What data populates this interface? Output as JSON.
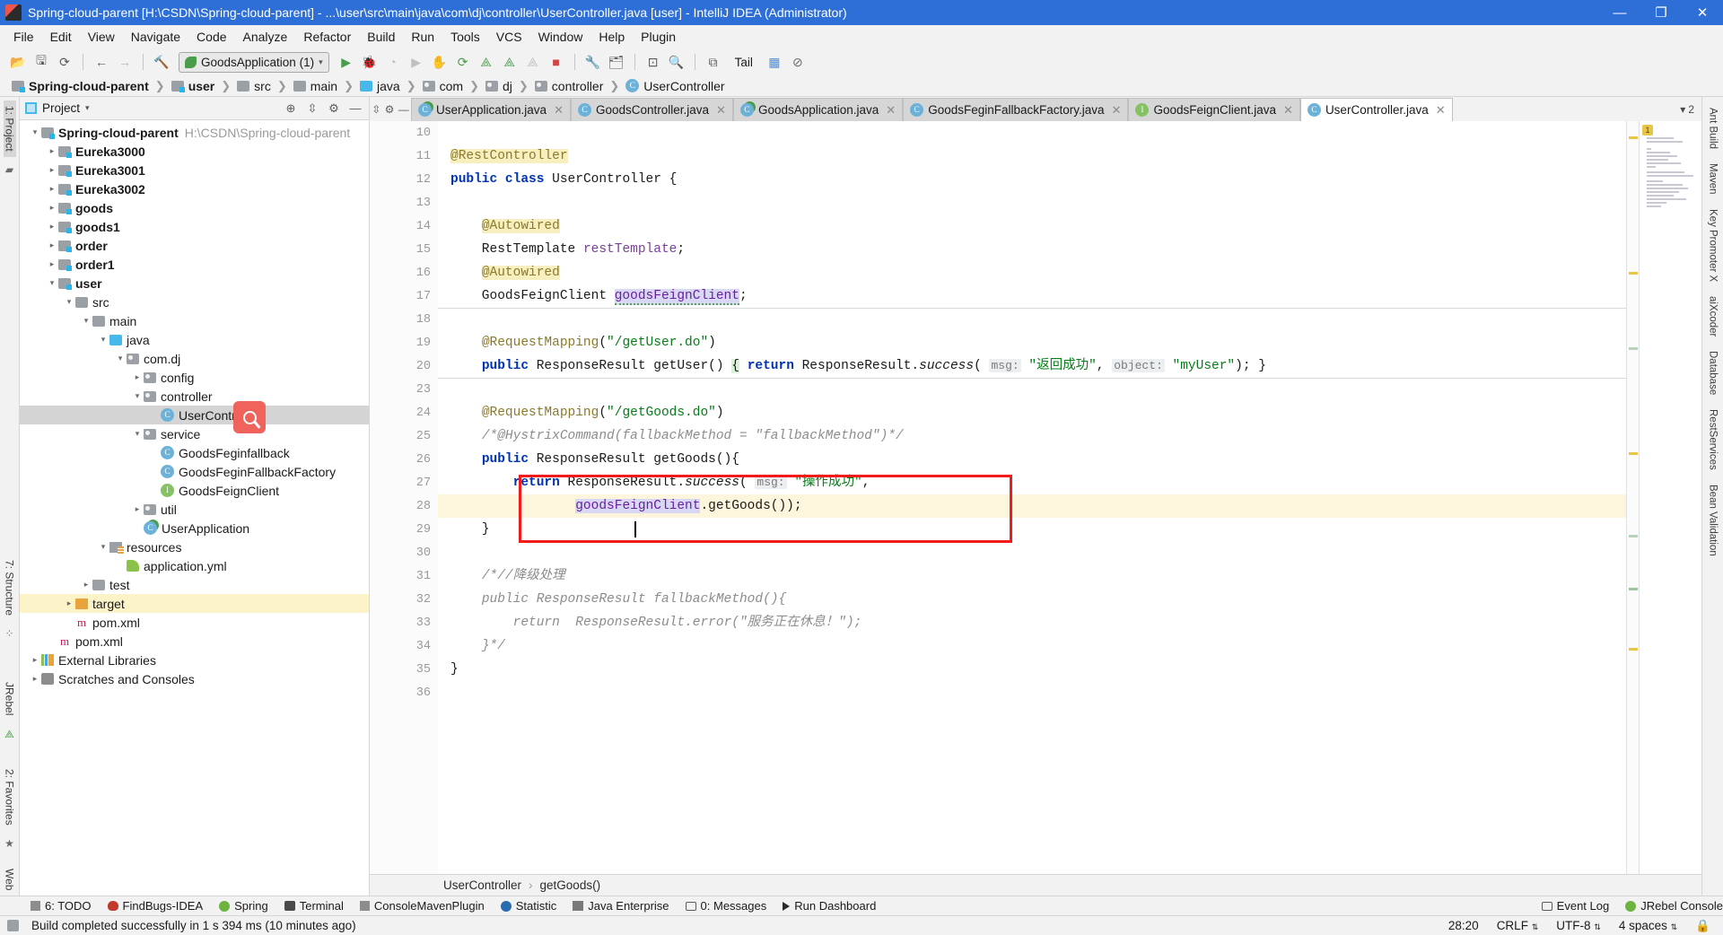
{
  "window": {
    "title": "Spring-cloud-parent [H:\\CSDN\\Spring-cloud-parent] - ...\\user\\src\\main\\java\\com\\dj\\controller\\UserController.java [user] - IntelliJ IDEA (Administrator)",
    "minimize": "—",
    "maximize": "❐",
    "close": "✕"
  },
  "menu": [
    "File",
    "Edit",
    "View",
    "Navigate",
    "Code",
    "Analyze",
    "Refactor",
    "Build",
    "Run",
    "Tools",
    "VCS",
    "Window",
    "Help",
    "Plugin"
  ],
  "toolbar": {
    "run_config": "GoodsApplication (1)",
    "tail_label": "Tail"
  },
  "breadcrumb": [
    {
      "label": "Spring-cloud-parent",
      "icon": "module-folder-icon",
      "bold": true
    },
    {
      "label": "user",
      "icon": "module-folder-icon",
      "bold": true
    },
    {
      "label": "src",
      "icon": "folder-icon",
      "bold": false
    },
    {
      "label": "main",
      "icon": "folder-icon",
      "bold": false
    },
    {
      "label": "java",
      "icon": "source-folder-icon",
      "bold": false
    },
    {
      "label": "com",
      "icon": "package-icon",
      "bold": false
    },
    {
      "label": "dj",
      "icon": "package-icon",
      "bold": false
    },
    {
      "label": "controller",
      "icon": "package-icon",
      "bold": false
    },
    {
      "label": "UserController",
      "icon": "class-icon",
      "bold": false
    }
  ],
  "left_rail": [
    "1: Project"
  ],
  "left_rail_lower": [
    "7: Structure",
    "JRebel",
    "2: Favorites",
    "Web"
  ],
  "right_rail": [
    "Ant Build",
    "Maven",
    "Key Promoter X",
    "aiXcoder",
    "Database",
    "RestServices",
    "Bean Validation"
  ],
  "project_panel": {
    "title": "Project",
    "tree": [
      {
        "indent": 0,
        "arrow": "open",
        "icon": "module-folder-icon",
        "label": "Spring-cloud-parent",
        "bold": true,
        "path": "H:\\CSDN\\Spring-cloud-parent"
      },
      {
        "indent": 1,
        "arrow": "closed",
        "icon": "module-folder-icon",
        "label": "Eureka3000",
        "bold": true,
        "path": ""
      },
      {
        "indent": 1,
        "arrow": "closed",
        "icon": "module-folder-icon",
        "label": "Eureka3001",
        "bold": true,
        "path": ""
      },
      {
        "indent": 1,
        "arrow": "closed",
        "icon": "module-folder-icon",
        "label": "Eureka3002",
        "bold": true,
        "path": ""
      },
      {
        "indent": 1,
        "arrow": "closed",
        "icon": "module-folder-icon",
        "label": "goods",
        "bold": true,
        "path": ""
      },
      {
        "indent": 1,
        "arrow": "closed",
        "icon": "module-folder-icon",
        "label": "goods1",
        "bold": true,
        "path": ""
      },
      {
        "indent": 1,
        "arrow": "closed",
        "icon": "module-folder-icon",
        "label": "order",
        "bold": true,
        "path": ""
      },
      {
        "indent": 1,
        "arrow": "closed",
        "icon": "module-folder-icon",
        "label": "order1",
        "bold": true,
        "path": ""
      },
      {
        "indent": 1,
        "arrow": "open",
        "icon": "module-folder-icon",
        "label": "user",
        "bold": true,
        "path": ""
      },
      {
        "indent": 2,
        "arrow": "open",
        "icon": "folder-icon",
        "label": "src",
        "bold": false,
        "path": ""
      },
      {
        "indent": 3,
        "arrow": "open",
        "icon": "folder-icon",
        "label": "main",
        "bold": false,
        "path": ""
      },
      {
        "indent": 4,
        "arrow": "open",
        "icon": "source-folder-icon",
        "label": "java",
        "bold": false,
        "path": ""
      },
      {
        "indent": 5,
        "arrow": "open",
        "icon": "package-icon",
        "label": "com.dj",
        "bold": false,
        "path": ""
      },
      {
        "indent": 6,
        "arrow": "closed",
        "icon": "package-icon",
        "label": "config",
        "bold": false,
        "path": ""
      },
      {
        "indent": 6,
        "arrow": "open",
        "icon": "package-icon",
        "label": "controller",
        "bold": false,
        "path": ""
      },
      {
        "indent": 7,
        "arrow": "none",
        "icon": "class-icon",
        "label": "UserController",
        "bold": false,
        "path": "",
        "selected": true
      },
      {
        "indent": 6,
        "arrow": "open",
        "icon": "package-icon",
        "label": "service",
        "bold": false,
        "path": ""
      },
      {
        "indent": 7,
        "arrow": "none",
        "icon": "class-icon",
        "label": "GoodsFeginfallback",
        "bold": false,
        "path": ""
      },
      {
        "indent": 7,
        "arrow": "none",
        "icon": "class-icon",
        "label": "GoodsFeginFallbackFactory",
        "bold": false,
        "path": ""
      },
      {
        "indent": 7,
        "arrow": "none",
        "icon": "interface-icon",
        "label": "GoodsFeignClient",
        "bold": false,
        "path": ""
      },
      {
        "indent": 6,
        "arrow": "closed",
        "icon": "package-icon",
        "label": "util",
        "bold": false,
        "path": ""
      },
      {
        "indent": 6,
        "arrow": "none",
        "icon": "spring-class-icon",
        "label": "UserApplication",
        "bold": false,
        "path": ""
      },
      {
        "indent": 4,
        "arrow": "open",
        "icon": "resources-folder-icon",
        "label": "resources",
        "bold": false,
        "path": ""
      },
      {
        "indent": 5,
        "arrow": "none",
        "icon": "yaml-icon",
        "label": "application.yml",
        "bold": false,
        "path": ""
      },
      {
        "indent": 3,
        "arrow": "closed",
        "icon": "folder-icon",
        "label": "test",
        "bold": false,
        "path": ""
      },
      {
        "indent": 2,
        "arrow": "closed",
        "icon": "target-folder-icon",
        "label": "target",
        "bold": false,
        "path": "",
        "highlight": true
      },
      {
        "indent": 2,
        "arrow": "none",
        "icon": "maven-icon",
        "label": "pom.xml",
        "bold": false,
        "path": ""
      },
      {
        "indent": 1,
        "arrow": "none",
        "icon": "maven-icon",
        "label": "pom.xml",
        "bold": false,
        "path": ""
      },
      {
        "indent": 0,
        "arrow": "closed",
        "icon": "library-icon",
        "label": "External Libraries",
        "bold": false,
        "path": ""
      },
      {
        "indent": 0,
        "arrow": "closed",
        "icon": "console-icon",
        "label": "Scratches and Consoles",
        "bold": false,
        "path": ""
      }
    ]
  },
  "editor": {
    "tabs": [
      {
        "label": "UserApplication.java",
        "icon": "spring-class-icon",
        "active": false
      },
      {
        "label": "GoodsController.java",
        "icon": "class-icon",
        "active": false
      },
      {
        "label": "GoodsApplication.java",
        "icon": "spring-class-icon",
        "active": false
      },
      {
        "label": "GoodsFeginFallbackFactory.java",
        "icon": "class-icon",
        "active": false
      },
      {
        "label": "GoodsFeignClient.java",
        "icon": "interface-icon",
        "active": false
      },
      {
        "label": "UserController.java",
        "icon": "class-icon",
        "active": true
      }
    ],
    "tab_overflow": "2",
    "line_numbers": [
      "10",
      "11",
      "12",
      "13",
      "14",
      "15",
      "16",
      "17",
      "18",
      "19",
      "20",
      "23",
      "24",
      "25",
      "26",
      "27",
      "28",
      "29",
      "30",
      "31",
      "32",
      "33",
      "34",
      "35",
      "36"
    ],
    "breadcrumb_bottom": [
      "UserController",
      "getGoods()"
    ],
    "error_count": "1"
  },
  "code_lines": [
    {
      "num": "10",
      "html": ""
    },
    {
      "num": "11",
      "html": "<span class='annhl'>@RestController</span>",
      "runmark": true
    },
    {
      "num": "12",
      "html": "<span class='kw'>public</span> <span class='kw'>class</span> UserController {",
      "runmark": true
    },
    {
      "num": "13",
      "html": ""
    },
    {
      "num": "14",
      "html": "    <span class='annhl'>@Autowired</span>"
    },
    {
      "num": "15",
      "html": "    RestTemplate <span class='fld'>restTemplate</span>;",
      "runmark": true
    },
    {
      "num": "16",
      "html": "    <span class='annhl'>@Autowired</span>"
    },
    {
      "num": "17",
      "html": "    GoodsFeignClient <span class='fldhl wavy'>goodsFeignClient</span>;",
      "runmark": true
    },
    {
      "num": "18",
      "html": "",
      "sep": true
    },
    {
      "num": "19",
      "html": "    <span class='ann'>@RequestMapping</span>(<span class='str'>\"/getUser.do\"</span>)"
    },
    {
      "num": "20",
      "html": "    <span class='kw'>public</span> ResponseResult getUser() <span class='brcmatch'>{</span> <span class='kw'>return</span> ResponseResult.<span class='itm'>success</span>( <span class='hint'>msg:</span> <span class='str'>\"返回成功\"</span>, <span class='hint'>object:</span> <span class='str'>\"myUser\"</span>); }",
      "fold": true
    },
    {
      "num": "23",
      "html": "",
      "sep": true
    },
    {
      "num": "24",
      "html": "    <span class='ann'>@RequestMapping</span>(<span class='str'>\"/getGoods.do\"</span>)"
    },
    {
      "num": "25",
      "html": "    <span class='cmt'>/*@HystrixCommand(fallbackMethod = \"fallbackMethod\")*/</span>"
    },
    {
      "num": "26",
      "html": "    <span class='kw'>public</span> ResponseResult getGoods(){",
      "fold": true
    },
    {
      "num": "27",
      "html": "        <span class='kw'>return</span> ResponseResult.<span class='itm'>success</span>( <span class='hint'>msg:</span> <span class='str'>\"操作成功\"</span>,"
    },
    {
      "num": "28",
      "html": "                <span class='fldhl'>goodsFeignClient</span>.getGoods());",
      "hl": true
    },
    {
      "num": "29",
      "html": "    }",
      "fold": true
    },
    {
      "num": "30",
      "html": ""
    },
    {
      "num": "31",
      "html": "    <span class='cmt'>/*//降级处理</span>",
      "fold": true
    },
    {
      "num": "32",
      "html": "    <span class='cmt'>public ResponseResult fallbackMethod(){</span>"
    },
    {
      "num": "33",
      "html": "        <span class='cmt'>return  ResponseResult.error(\"服务正在休息！\");</span>"
    },
    {
      "num": "34",
      "html": "    <span class='cmt'>}*/</span>",
      "fold": true
    },
    {
      "num": "35",
      "html": "}"
    },
    {
      "num": "36",
      "html": ""
    }
  ],
  "bottom_tools": [
    {
      "label": "6: TODO",
      "icon": "todo-icon"
    },
    {
      "label": "FindBugs-IDEA",
      "icon": "findbugs-icon"
    },
    {
      "label": "Spring",
      "icon": "spring-icon"
    },
    {
      "label": "Terminal",
      "icon": "terminal-icon"
    },
    {
      "label": "ConsoleMavenPlugin",
      "icon": "maven-plugin-icon"
    },
    {
      "label": "Statistic",
      "icon": "statistic-icon"
    },
    {
      "label": "Java Enterprise",
      "icon": "java-enterprise-icon"
    },
    {
      "label": "0: Messages",
      "icon": "messages-icon"
    },
    {
      "label": "Run Dashboard",
      "icon": "run-dashboard-icon"
    }
  ],
  "bottom_tools_right": [
    {
      "label": "Event Log",
      "icon": "event-log-icon"
    },
    {
      "label": "JRebel Console",
      "icon": "jrebel-icon"
    }
  ],
  "status_bar": {
    "message": "Build completed successfully in 1 s 394 ms (10 minutes ago)",
    "position": "28:20",
    "line_sep": "CRLF",
    "encoding": "UTF-8",
    "indent": "4 spaces",
    "lock": "🔒"
  },
  "colors": {
    "title_bg": "#2d6fd6",
    "accent": "#46b8e9",
    "keyword": "#0033b3",
    "string": "#067d17",
    "annotation": "#8a7a2a",
    "redbox": "#f21a1a",
    "magnifier": "#f0625c"
  }
}
